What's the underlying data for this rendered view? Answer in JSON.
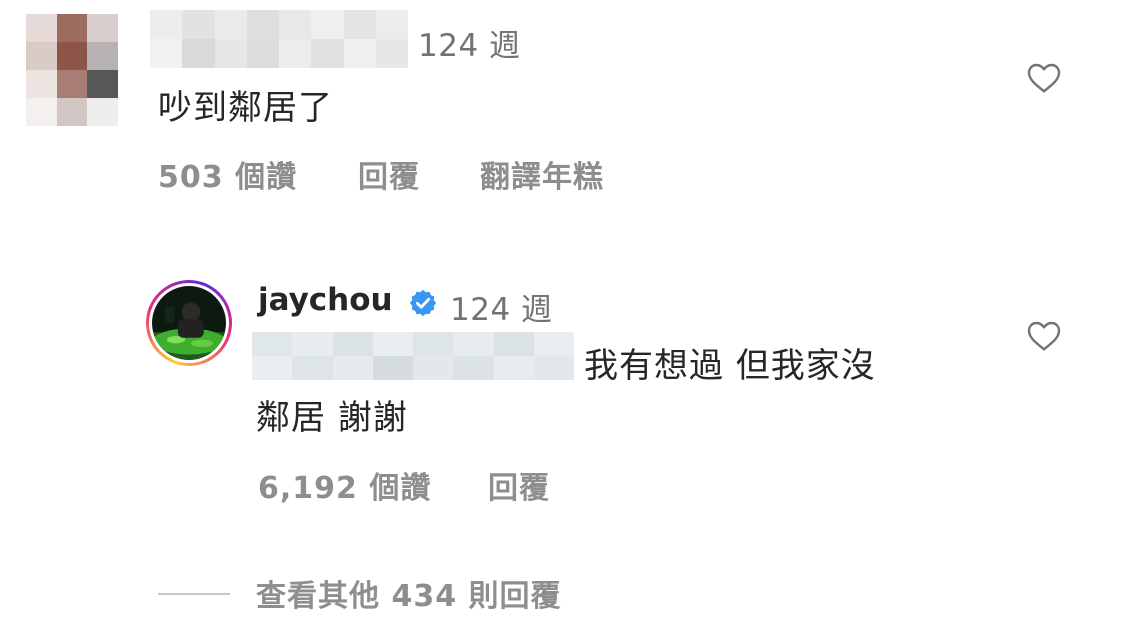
{
  "comment": {
    "time": "124 週",
    "text": "吵到鄰居了",
    "likes": "503 個讚",
    "reply_label": "回覆",
    "translate_label": "翻譯年糕"
  },
  "reply": {
    "username": "jaychou",
    "time": "124 週",
    "text_line1": "我有想過 但我家沒",
    "text_line2": "鄰居 謝謝",
    "likes": "6,192 個讚",
    "reply_label": "回覆"
  },
  "view_more": {
    "label": "查看其他 434 則回覆"
  },
  "icons": {
    "like": "heart-outline-icon",
    "verified": "verified-badge-icon"
  },
  "colors": {
    "text_primary": "#262626",
    "text_secondary": "#737373",
    "action_text": "#8e8e8e",
    "verified_blue": "#3897f0"
  }
}
